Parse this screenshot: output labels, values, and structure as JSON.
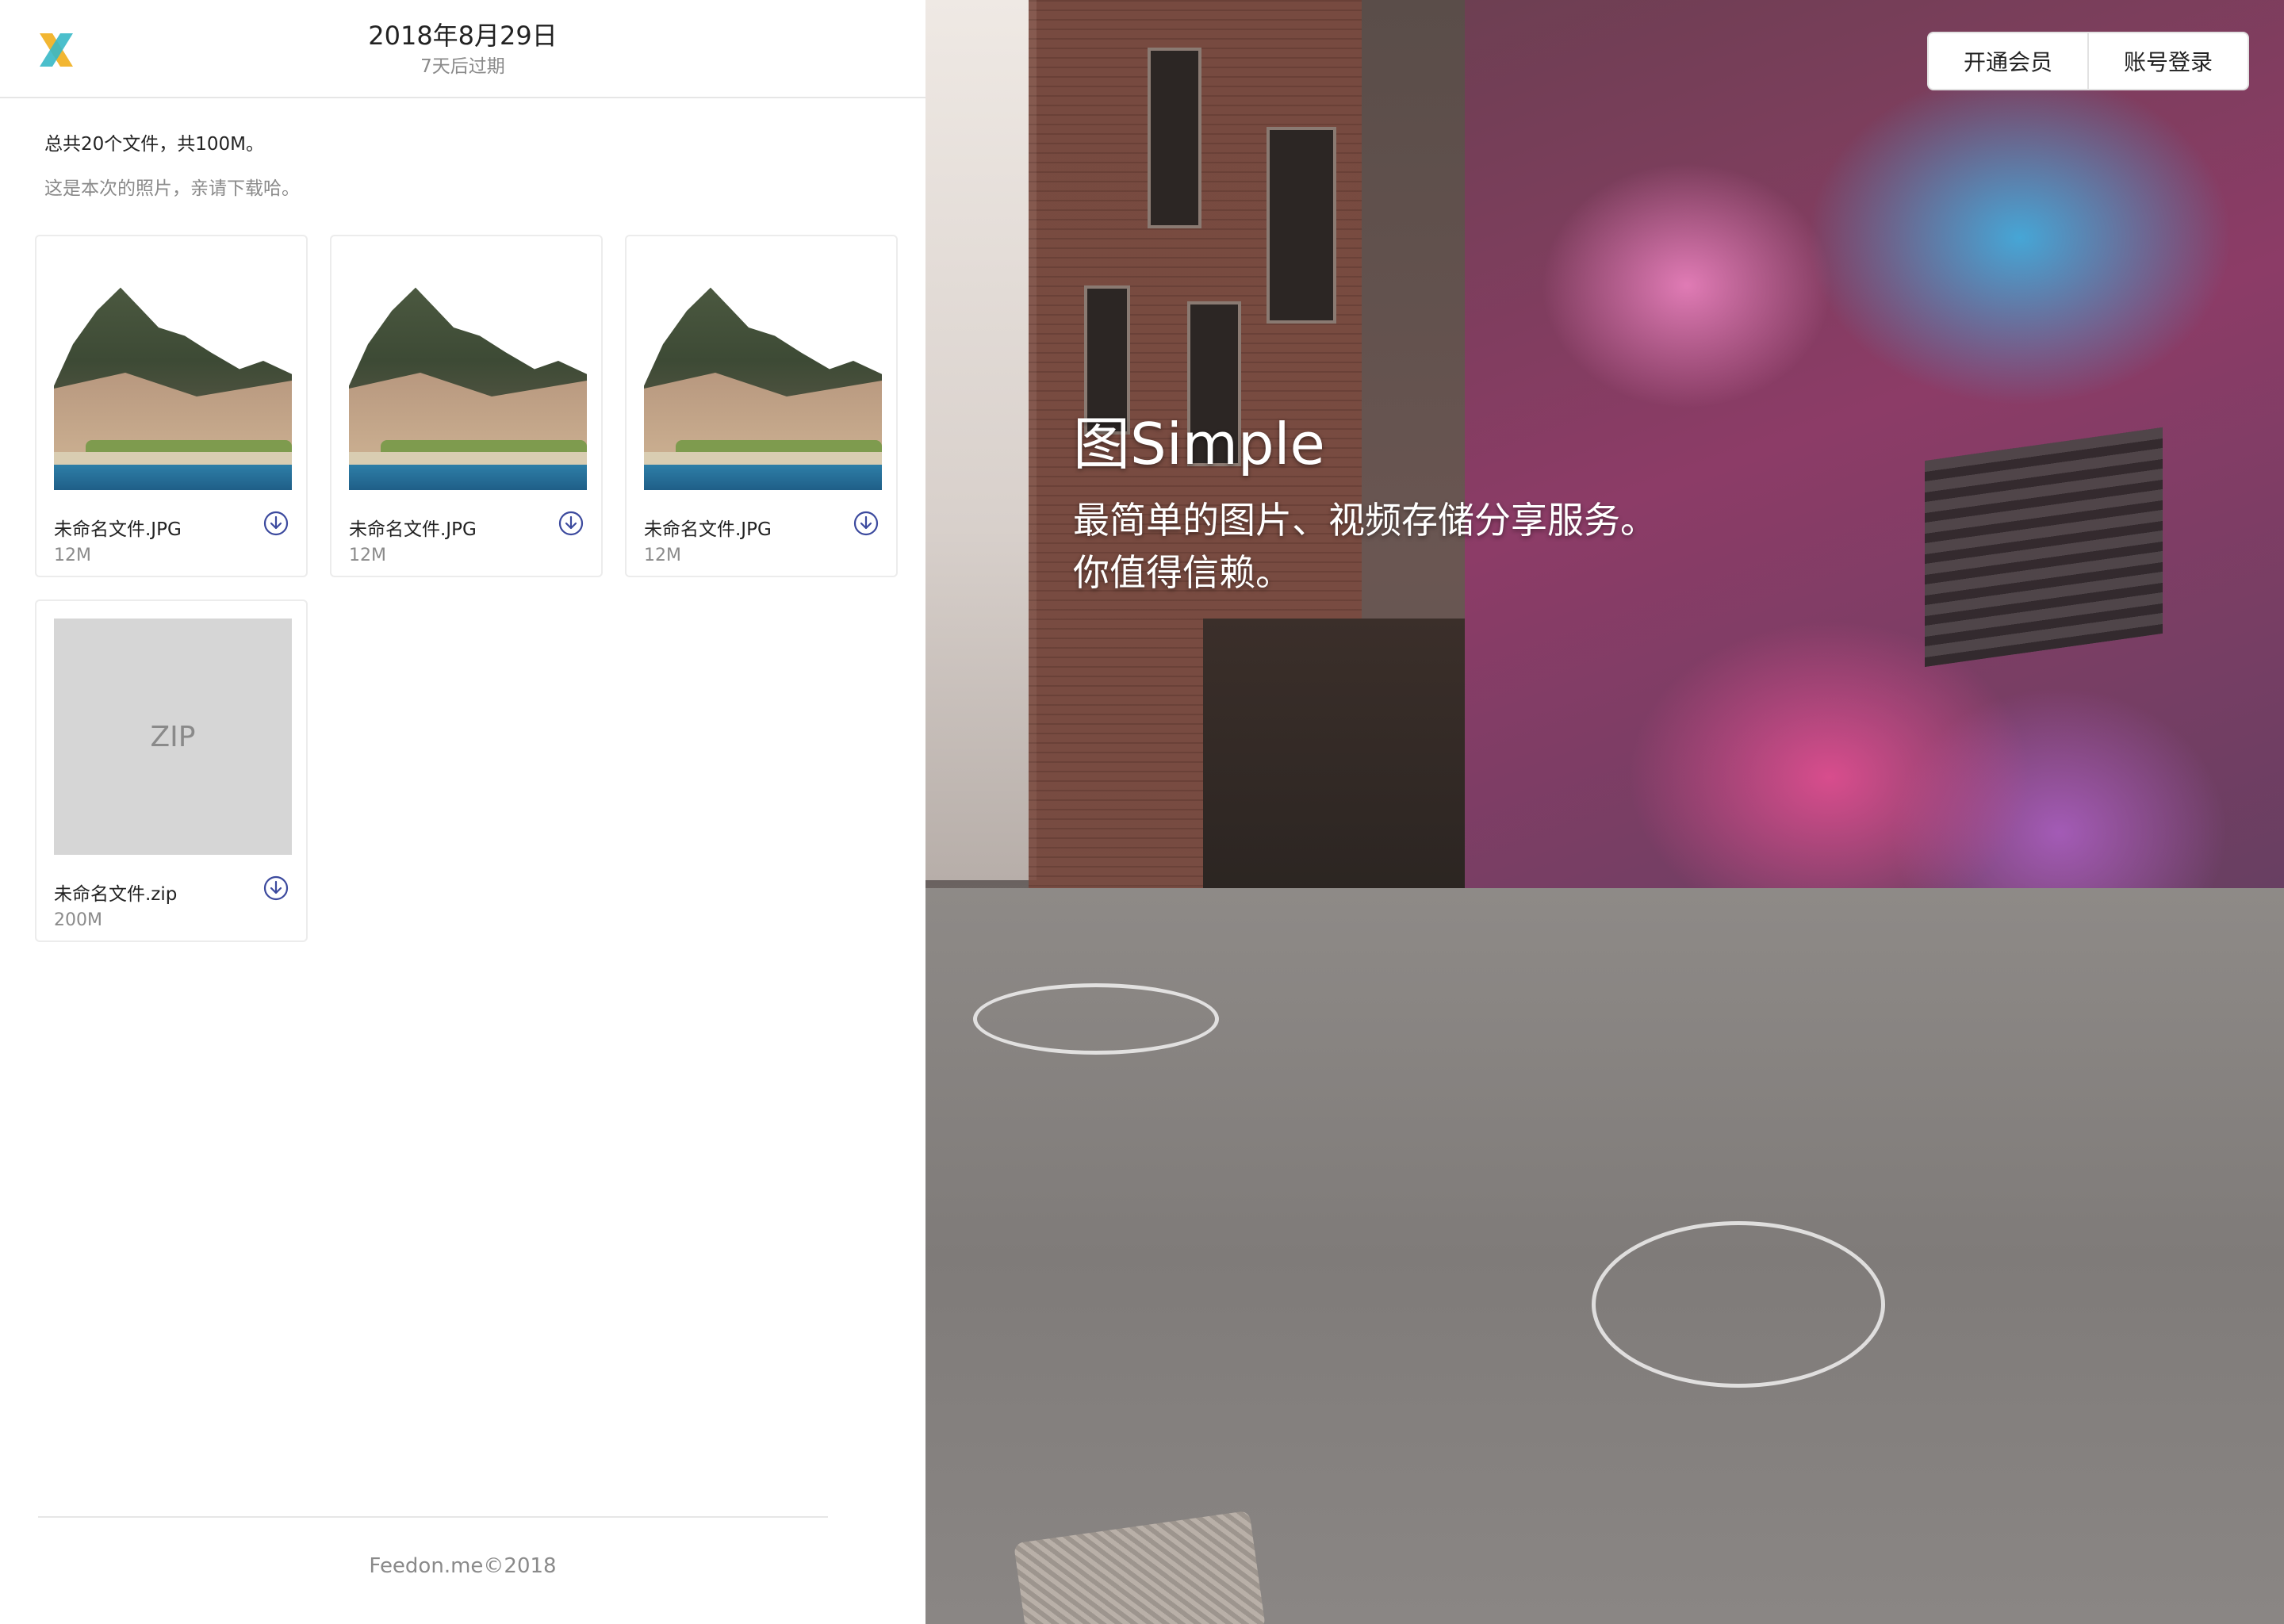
{
  "header": {
    "date": "2018年8月29日",
    "expire": "7天后过期",
    "logo_icon": "feedon-x-logo-icon"
  },
  "summary": {
    "total": "总共20个文件，共100M。",
    "note": "这是本次的照片，亲请下载哈。"
  },
  "files": [
    {
      "name": "未命名文件.JPG",
      "size": "12M",
      "type": "photo"
    },
    {
      "name": "未命名文件.JPG",
      "size": "12M",
      "type": "photo"
    },
    {
      "name": "未命名文件.JPG",
      "size": "12M",
      "type": "photo"
    },
    {
      "name": "未命名文件.zip",
      "size": "200M",
      "type": "zip",
      "thumb_label": "ZIP"
    }
  ],
  "footer": {
    "copyright": "Feedon.me©2018"
  },
  "hero": {
    "title": "图Simple",
    "subtitle_line1": "最简单的图片、视频存储分享服务。",
    "subtitle_line2": "你值得信赖。"
  },
  "top_actions": {
    "membership": "开通会员",
    "login": "账号登录"
  },
  "colors": {
    "accent_icon": "#3c4a9e",
    "text_primary": "#222222",
    "text_secondary": "#8a8a8a",
    "logo_yellow": "#f2b632",
    "logo_teal": "#37b8c6"
  }
}
